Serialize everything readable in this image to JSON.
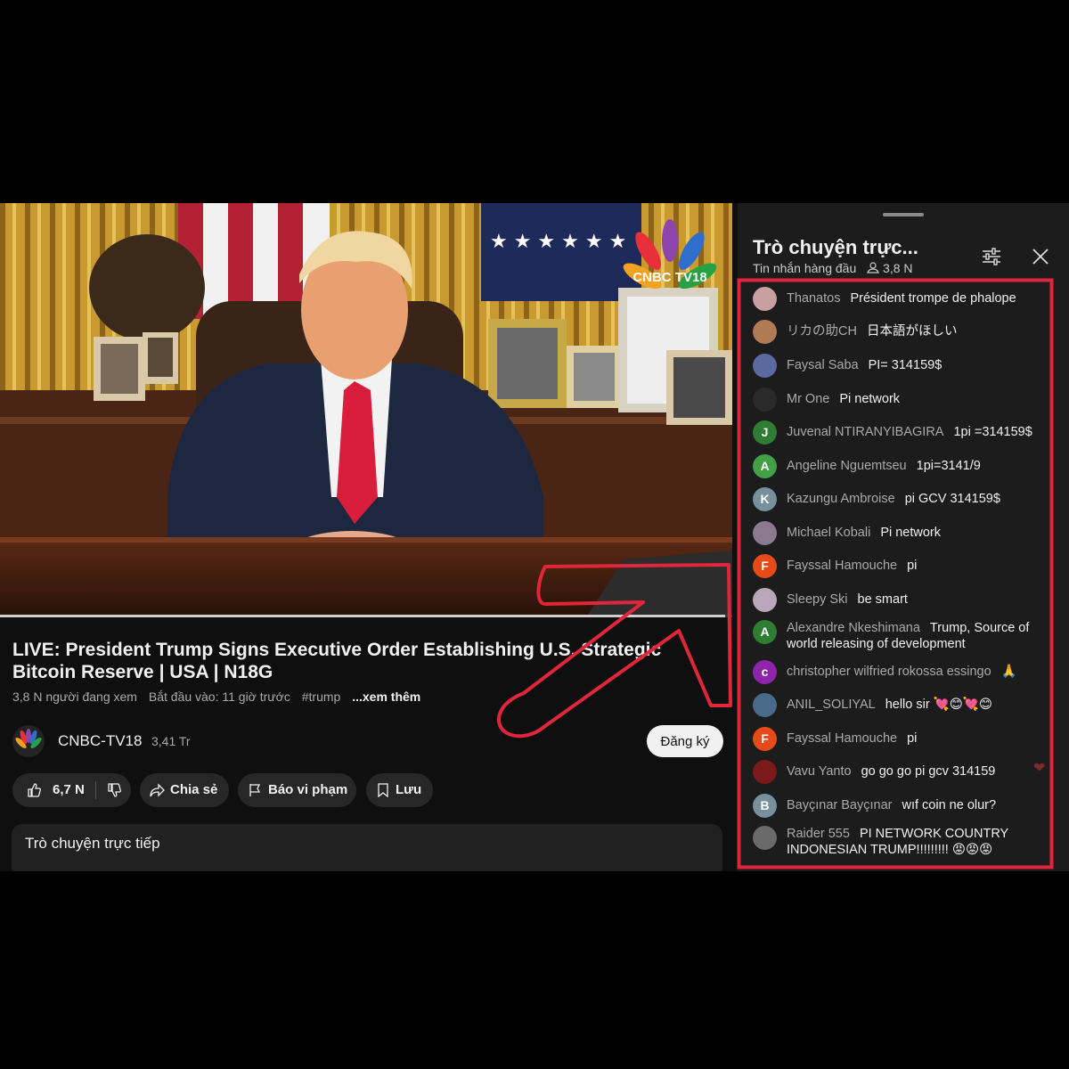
{
  "video": {
    "channel_logo_text": "CNBC TV18",
    "progress_fraction": 0.99
  },
  "info": {
    "title": "LIVE: President Trump Signs Executive Order Establishing U.S. Strategic Bitcoin Reserve | USA | N18G",
    "viewers": "3,8 N người đang xem",
    "started": "Bắt đầu vào: 11 giờ trước",
    "hashtag": "#trump",
    "more": "...xem thêm"
  },
  "channel": {
    "name": "CNBC-TV18",
    "subscribers": "3,41 Tr",
    "subscribe_label": "Đăng ký"
  },
  "actions": {
    "likes": "6,7 N",
    "share": "Chia sẻ",
    "report": "Báo vi phạm",
    "save": "Lưu"
  },
  "live_chat_box": {
    "label": "Trò chuyện trực tiếp"
  },
  "chat": {
    "title": "Trò chuyện trực...",
    "mode": "Tin nhắn hàng đầu",
    "viewer_count": "3,8 N",
    "messages": [
      {
        "author": "Thanatos",
        "text": "Président trompe de phalope",
        "initial": "",
        "color": "#c9a0a0"
      },
      {
        "author": "リカの助CH",
        "text": "日本語がほしい",
        "initial": "",
        "color": "#b07a55"
      },
      {
        "author": "Faysal Saba",
        "text": "PI= 314159$",
        "initial": "",
        "color": "#5a6aa0"
      },
      {
        "author": "Mr One",
        "text": "Pi network",
        "initial": "",
        "color": "#2a2a2a"
      },
      {
        "author": "Juvenal NTIRANYIBAGIRA",
        "text": "1pi =314159$",
        "initial": "J",
        "color": "#2e7d32"
      },
      {
        "author": "Angeline Nguemtseu",
        "text": "1pi=3141/9",
        "initial": "A",
        "color": "#43a047"
      },
      {
        "author": "Kazungu Ambroise",
        "text": "pi GCV 314159$",
        "initial": "K",
        "color": "#78909c"
      },
      {
        "author": "Michael Kobali",
        "text": "Pi network",
        "initial": "",
        "color": "#8a7a90"
      },
      {
        "author": "Fayssal Hamouche",
        "text": "pi",
        "initial": "F",
        "color": "#e64a19"
      },
      {
        "author": "Sleepy Ski",
        "text": "be smart",
        "initial": "",
        "color": "#b9a7b9"
      },
      {
        "author": "Alexandre Nkeshimana",
        "text": "Trump, Source of world releasing of development",
        "initial": "A",
        "color": "#2e7d32"
      },
      {
        "author": "christopher wilfried rokossa essingo",
        "text": "🙏",
        "initial": "c",
        "color": "#8e24aa"
      },
      {
        "author": "ANIL_SOLIYAL",
        "text": "hello sir 💘😊💘😊",
        "initial": "",
        "color": "#4a6a8a"
      },
      {
        "author": "Fayssal Hamouche",
        "text": "pi",
        "initial": "F",
        "color": "#e64a19"
      },
      {
        "author": "Vavu Yanto",
        "text": "go go go pi gcv 314159",
        "initial": "",
        "color": "#7a1a1a"
      },
      {
        "author": "Bayçınar Bayçınar",
        "text": "wıf coin ne olur?",
        "initial": "B",
        "color": "#78909c"
      },
      {
        "author": "Raider 555",
        "text": "PI NETWORK COUNTRY INDONESIAN TRUMP!!!!!!!!! 😡😡😡",
        "initial": "",
        "color": "#6a6a6a"
      }
    ]
  },
  "colors": {
    "background": "#0f0f0f",
    "chat_panel": "#1c1c1c",
    "annotation_red": "#e0263a"
  }
}
